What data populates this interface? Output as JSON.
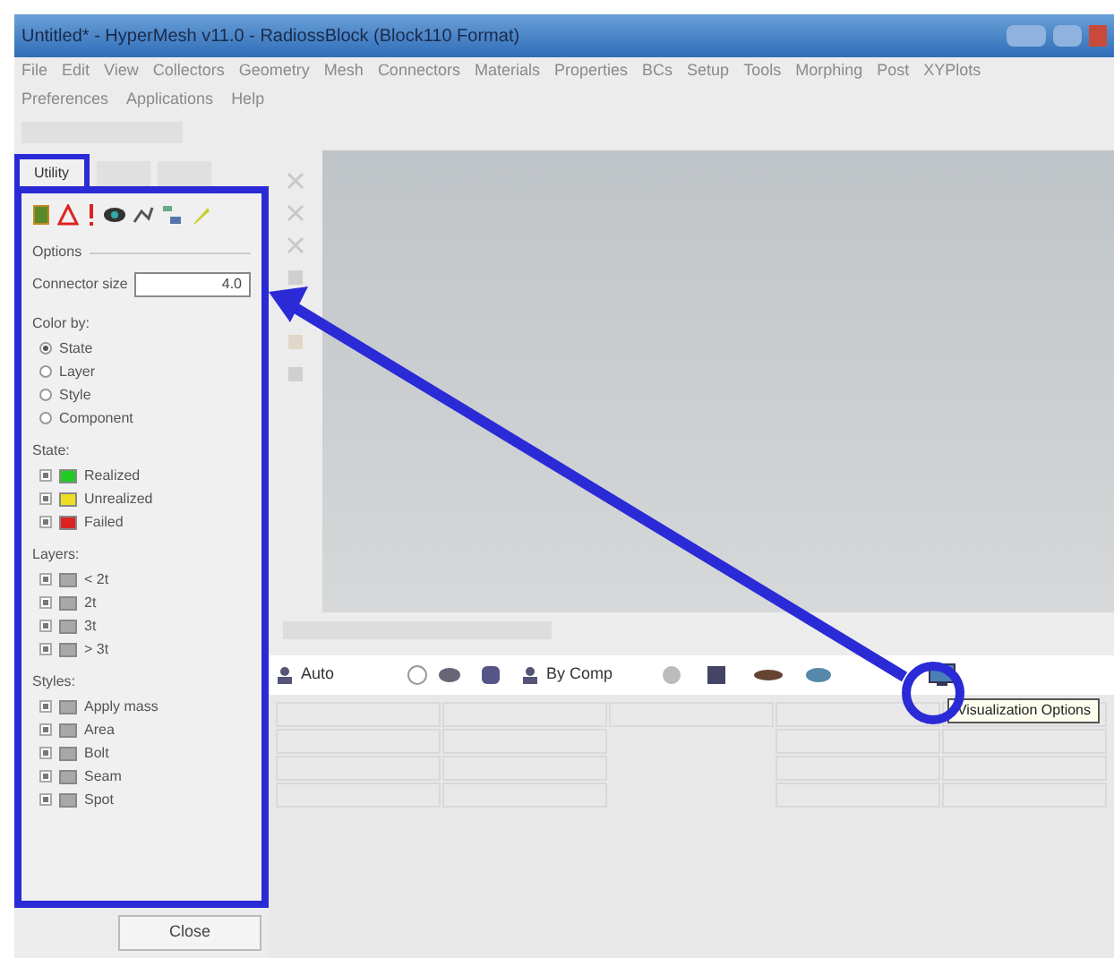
{
  "window": {
    "title": "Untitled* - HyperMesh v11.0 - RadiossBlock (Block110 Format)"
  },
  "menu": [
    "File",
    "Edit",
    "View",
    "Collectors",
    "Geometry",
    "Mesh",
    "Connectors",
    "Materials",
    "Properties",
    "BCs",
    "Setup",
    "Tools",
    "Morphing",
    "Post",
    "XYPlots"
  ],
  "menu_row2": [
    "Preferences",
    "Applications",
    "Help"
  ],
  "panel": {
    "tabs": [
      {
        "label": "Utility",
        "selected": true
      }
    ],
    "options_label": "Options",
    "connector_size": {
      "label": "Connector size",
      "value": "4.0"
    },
    "color_by": {
      "label": "Color by:",
      "options": [
        {
          "label": "State",
          "selected": true
        },
        {
          "label": "Layer",
          "selected": false
        },
        {
          "label": "Style",
          "selected": false
        },
        {
          "label": "Component",
          "selected": false
        }
      ]
    },
    "state": {
      "label": "State:",
      "items": [
        {
          "label": "Realized",
          "checked": true,
          "color": "#22cc22"
        },
        {
          "label": "Unrealized",
          "checked": true,
          "color": "#eedd22"
        },
        {
          "label": "Failed",
          "checked": true,
          "color": "#dd2222"
        }
      ]
    },
    "layers": {
      "label": "Layers:",
      "items": [
        {
          "label": "< 2t",
          "checked": true
        },
        {
          "label": "2t",
          "checked": true
        },
        {
          "label": "3t",
          "checked": true
        },
        {
          "label": "> 3t",
          "checked": true
        }
      ]
    },
    "styles": {
      "label": "Styles:",
      "items": [
        {
          "label": "Apply mass",
          "checked": true
        },
        {
          "label": "Area",
          "checked": true
        },
        {
          "label": "Bolt",
          "checked": true
        },
        {
          "label": "Seam",
          "checked": true
        },
        {
          "label": "Spot",
          "checked": true
        }
      ]
    },
    "close_button": "Close"
  },
  "toolbar": {
    "display_mode": "Auto",
    "color_mode": "By Comp"
  },
  "tooltip": "Visualization Options"
}
